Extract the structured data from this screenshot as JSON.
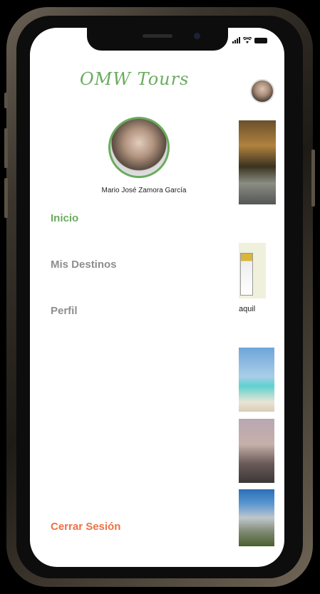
{
  "app": {
    "logo_text": "OMW Tours"
  },
  "user": {
    "name": "Mario José Zamora García"
  },
  "menu": {
    "items": [
      {
        "label": "Inicio",
        "active": true
      },
      {
        "label": "Mis Destinos",
        "active": false
      },
      {
        "label": "Perfil",
        "active": false
      }
    ],
    "logout_label": "Cerrar Sesión"
  },
  "background_content": {
    "partial_card_text": "aquil"
  },
  "colors": {
    "accent": "#6aab5e",
    "inactive": "#8e8e8e",
    "logout": "#ef7043"
  }
}
